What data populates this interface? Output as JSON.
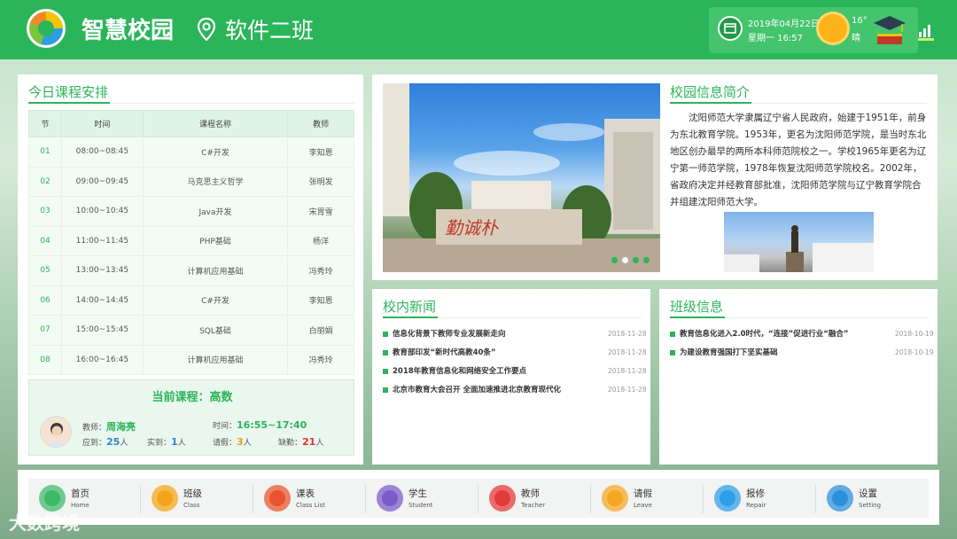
{
  "header": {
    "app_title": "智慧校园",
    "class_name": "软件二班",
    "date": "2019年04月22日",
    "weekday_time": "星期一  16:57",
    "temperature": "16°",
    "weather": "晴"
  },
  "schedule": {
    "title": "今日课程安排",
    "columns": [
      "节",
      "时间",
      "课程名称",
      "教师"
    ],
    "rows": [
      [
        "01",
        "08:00~08:45",
        "C#开发",
        "李知恩"
      ],
      [
        "02",
        "09:00~09:45",
        "马克思主义哲学",
        "张明发"
      ],
      [
        "03",
        "10:00~10:45",
        "Java开发",
        "宋胃雪"
      ],
      [
        "04",
        "11:00~11:45",
        "PHP基础",
        "杨洋"
      ],
      [
        "05",
        "13:00~13:45",
        "计算机应用基础",
        "冯秀玲"
      ],
      [
        "06",
        "14:00~14:45",
        "C#开发",
        "李知恩"
      ],
      [
        "07",
        "15:00~15:45",
        "SQL基础",
        "白丽娟"
      ],
      [
        "08",
        "16:00~16:45",
        "计算机应用基础",
        "冯秀玲"
      ]
    ]
  },
  "current": {
    "title_label": "当前课程：",
    "course": "高数",
    "teacher_label": "教师：",
    "teacher": "周海亮",
    "time_label": "时间：",
    "time": "16:55~17:40",
    "due_label": "应到：",
    "due": "25",
    "present_label": "实到：",
    "present": "1",
    "leave_label": "请假：",
    "leave": "3",
    "absent_label": "缺勤：",
    "absent": "21",
    "unit": "人"
  },
  "campus": {
    "title": "校园信息简介",
    "banner_text": "勤诚朴",
    "intro": "沈阳师范大学隶属辽宁省人民政府，始建于1951年，前身为东北教育学院。1953年，更名为沈阳师范学院，是当时东北地区创办最早的两所本科师范院校之一。学校1965年更名为辽宁第一师范学院，1978年恢复沈阳师范学院校名。2002年，省政府决定并经教育部批准，沈阳师范学院与辽宁教育学院合并组建沈阳师范大学。"
  },
  "school_news": {
    "title": "校内新闻",
    "items": [
      {
        "text": "信息化背景下教师专业发展新走向",
        "date": "2018-11-28"
      },
      {
        "text": "教育部印发“新时代高教40条”",
        "date": "2018-11-28"
      },
      {
        "text": "2018年教育信息化和网络安全工作要点",
        "date": "2018-11-28"
      },
      {
        "text": "北京市教育大会召开 全面加速推进北京教育现代化",
        "date": "2018-11-28"
      }
    ]
  },
  "class_news": {
    "title": "班级信息",
    "items": [
      {
        "text": "教育信息化进入2.0时代，“连接”促进行业“融合”",
        "date": "2018-10-19"
      },
      {
        "text": "为建设教育强国打下坚实基础",
        "date": "2018-10-19"
      }
    ]
  },
  "nav": [
    {
      "label": "首页",
      "sub": "Home",
      "color": "#3fb86a"
    },
    {
      "label": "班级",
      "sub": "Class",
      "color": "#f2a51a"
    },
    {
      "label": "课表",
      "sub": "Class List",
      "color": "#e8542f"
    },
    {
      "label": "学生",
      "sub": "Student",
      "color": "#7b5bc9"
    },
    {
      "label": "教师",
      "sub": "Teacher",
      "color": "#e23a3a"
    },
    {
      "label": "请假",
      "sub": "Leave",
      "color": "#f5a623"
    },
    {
      "label": "报修",
      "sub": "Repair",
      "color": "#2e9ee6"
    },
    {
      "label": "设置",
      "sub": "Setting",
      "color": "#2d8fd9"
    }
  ],
  "watermark": "大数跨境"
}
